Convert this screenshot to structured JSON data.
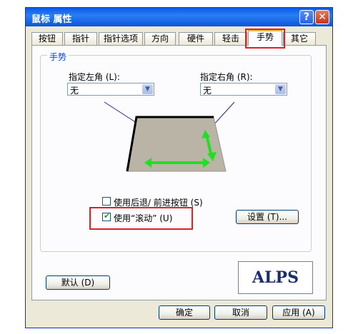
{
  "window": {
    "title": "鼠标 属性",
    "help_glyph": "?",
    "close_glyph": "✕"
  },
  "tabs": [
    {
      "label": "按钮"
    },
    {
      "label": "指针"
    },
    {
      "label": "指针选项"
    },
    {
      "label": "方向"
    },
    {
      "label": "硬件"
    },
    {
      "label": "轻击"
    },
    {
      "label": "手势",
      "active": true
    },
    {
      "label": "其它"
    }
  ],
  "gesture_group": {
    "label": "手势",
    "left_corner": {
      "label": "指定左角 (L):",
      "value": "无"
    },
    "right_corner": {
      "label": "指定右角 (R):",
      "value": "无"
    },
    "back_forward_checkbox": {
      "label": "使用后退/ 前进按钮 (S)",
      "checked": false
    },
    "scroll_checkbox": {
      "label": "使用“滚动” (U)",
      "checked": true
    },
    "settings_button": "设置 (T)..."
  },
  "default_button": "默认 (D)",
  "logo_text": "ALPS",
  "footer": {
    "ok": "确定",
    "cancel": "取消",
    "apply": "应用 (A)"
  },
  "colors": {
    "title_bar": "#0a5be8",
    "highlight": "#e02020",
    "arrow": "#21e021",
    "touchpad": "#b9b4a6"
  }
}
